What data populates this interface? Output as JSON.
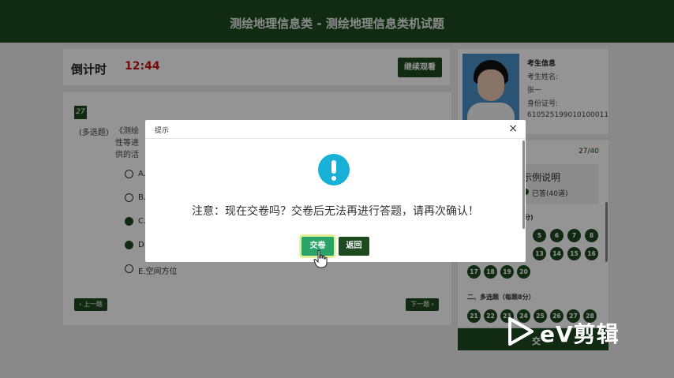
{
  "header": {
    "title": "测绘地理信息类 - 测绘地理信息类机试题"
  },
  "timer": {
    "label": "倒计时",
    "value": "12:44",
    "continue_label": "继续观看"
  },
  "question": {
    "number": "27",
    "type": "(多选题)",
    "stem_lines": [
      "《测绘",
      "性等进",
      "供的活"
    ],
    "options": [
      {
        "label": "A.",
        "selected": false
      },
      {
        "label": "B.",
        "selected": false
      },
      {
        "label": "C.",
        "selected": true
      },
      {
        "label": "D.",
        "selected": true
      },
      {
        "label": "E.空间方位",
        "selected": false
      }
    ],
    "prev_label": "‹ 上一题",
    "next_label": "下一题 ›"
  },
  "candidate": {
    "title": "考生信息",
    "name_label": "考生姓名:",
    "name": "张一",
    "id_label": "身份证号:",
    "id": "610525199010100011"
  },
  "answer_sheet": {
    "current": "27",
    "total": "/40",
    "legend_title": "示例说明",
    "legend_answered": "已答(40道)",
    "section1_partial": "分)",
    "section1_numbers": [
      "5",
      "6",
      "7",
      "8",
      "13",
      "14",
      "15",
      "16",
      "17",
      "18",
      "19",
      "20"
    ],
    "section2_label": "二、多选题（每题8分）",
    "section2_numbers": [
      "21",
      "22",
      "23",
      "24",
      "25",
      "26",
      "27",
      "28"
    ],
    "submit_partial": "交"
  },
  "dialog": {
    "title": "提示",
    "close": "×",
    "message": "注意：现在交卷吗？交卷后无法再进行答题，请再次确认！",
    "submit_label": "交卷",
    "back_label": "返回"
  },
  "watermark": {
    "text": "eV剪辑"
  },
  "colors": {
    "primary": "#1e4a22",
    "accent_info": "#19b0d8",
    "timer": "#c81414",
    "submit": "#2aa368"
  },
  "icons": {
    "warning": "exclamation-circle-icon",
    "close": "close-icon",
    "cursor": "hand-pointer-icon"
  }
}
